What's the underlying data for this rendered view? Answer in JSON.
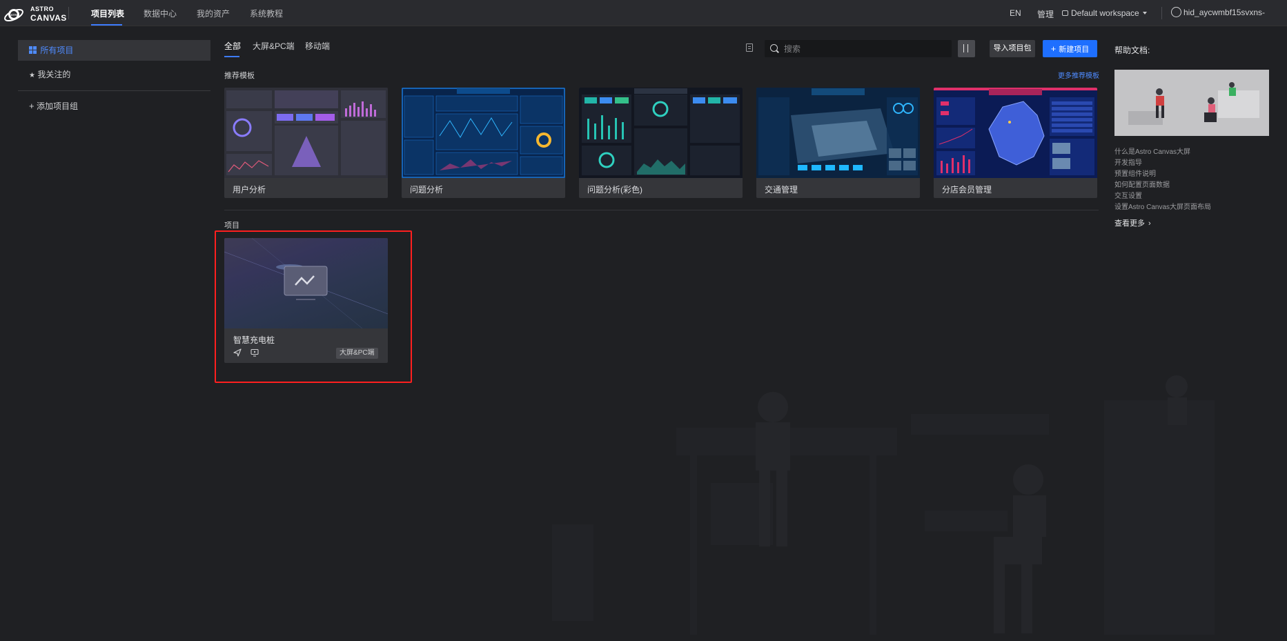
{
  "app": {
    "logo_top": "ASTRO",
    "logo_bottom": "CANVAS"
  },
  "nav": {
    "items": [
      {
        "label": "项目列表",
        "active": true
      },
      {
        "label": "数据中心",
        "active": false
      },
      {
        "label": "我的资产",
        "active": false
      },
      {
        "label": "系统教程",
        "active": false
      }
    ]
  },
  "topbar": {
    "lang": "EN",
    "manage": "管理",
    "workspace": "Default workspace",
    "user": "hid_aycwmbf15svxns-"
  },
  "sidebar": {
    "items": [
      {
        "label": "所有项目",
        "icon": "grid-icon",
        "active": true
      },
      {
        "label": "我关注的",
        "icon": "star-icon",
        "active": false
      }
    ],
    "add_group": "添加项目组"
  },
  "filter_tabs": [
    {
      "label": "全部",
      "active": true
    },
    {
      "label": "大屏&PC端",
      "active": false
    },
    {
      "label": "移动端",
      "active": false
    }
  ],
  "toolbar": {
    "search_placeholder": "搜索",
    "import_label": "导入项目包",
    "new_label": "新建项目"
  },
  "templates": {
    "section_title": "推荐模板",
    "more_label": "更多推荐模板",
    "items": [
      {
        "label": "用户分析",
        "theme": "#33343f"
      },
      {
        "label": "问题分析",
        "theme": "#0b2a55"
      },
      {
        "label": "问题分析(彩色)",
        "theme": "#151a22"
      },
      {
        "label": "交通管理",
        "theme": "#0e2a4a"
      },
      {
        "label": "分店会员管理",
        "theme": "#0c1a55"
      }
    ]
  },
  "projects": {
    "section_title": "项目",
    "items": [
      {
        "title": "智慧充电桩",
        "tag": "大屏&PC端"
      }
    ]
  },
  "help": {
    "title": "帮助文档:",
    "links": [
      "什么是Astro Canvas大屏",
      "开发指导",
      "预置组件说明",
      "如何配置页面数据",
      "交互设置",
      "设置Astro Canvas大屏页面布局"
    ],
    "more": "查看更多"
  },
  "colors": {
    "accent": "#1e6fff",
    "highlight": "#ff1f1f",
    "background": "#1f2023"
  }
}
